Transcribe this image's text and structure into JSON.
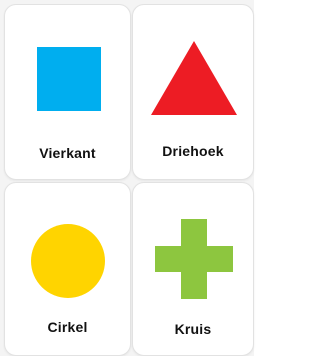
{
  "cards": [
    {
      "label": "Vierkant",
      "shape": "square-icon",
      "color": "#00AEEF"
    },
    {
      "label": "Driehoek",
      "shape": "triangle-icon",
      "color": "#ED1C24"
    },
    {
      "label": "Cirkel",
      "shape": "circle-icon",
      "color": "#FFD400"
    },
    {
      "label": "Kruis",
      "shape": "cross-icon",
      "color": "#8DC63F"
    }
  ]
}
